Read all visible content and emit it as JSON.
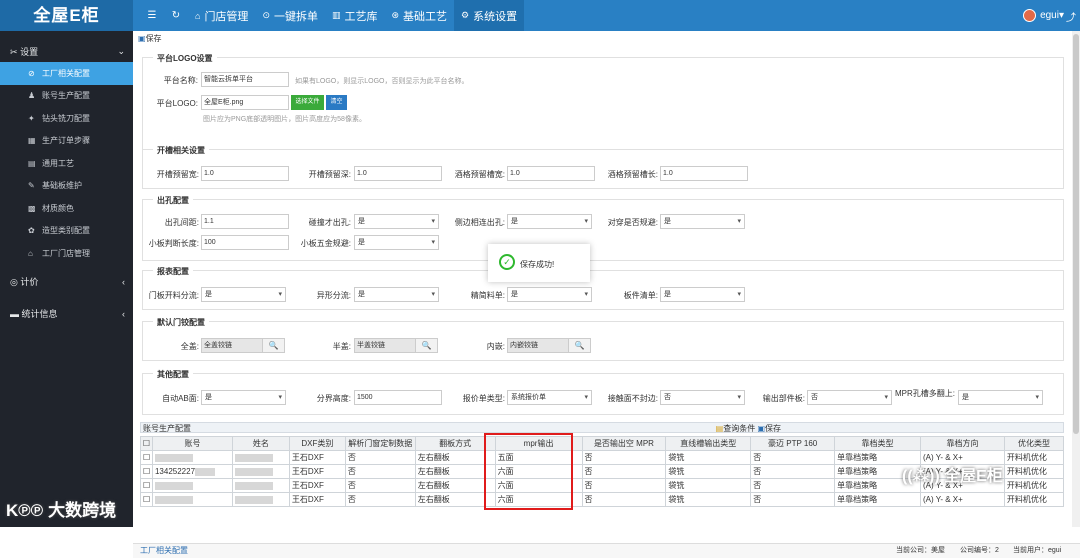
{
  "app": {
    "logo": "全屋E柜",
    "user": "egui",
    "user_caret": "▾",
    "exit_icon": "⤴",
    "top_icons": [
      "☰",
      "↻"
    ],
    "nav": [
      {
        "icon": "⌂",
        "label": "门店管理"
      },
      {
        "icon": "⊙",
        "label": "一键拆单"
      },
      {
        "icon": "▥",
        "label": "工艺库"
      },
      {
        "icon": "⊛",
        "label": "基础工艺"
      },
      {
        "icon": "⚙",
        "label": "系统设置",
        "active": true
      }
    ]
  },
  "sidebar": {
    "group1": {
      "icon": "✂",
      "label": "设置",
      "caret": "⌄"
    },
    "items": [
      {
        "icon": "⊘",
        "label": "工厂相关配置",
        "active": true
      },
      {
        "icon": "♟",
        "label": "账号生产配置"
      },
      {
        "icon": "✦",
        "label": "钻头铣刀配置"
      },
      {
        "icon": "▦",
        "label": "生产订单步骤"
      },
      {
        "icon": "▤",
        "label": "通用工艺"
      },
      {
        "icon": "✎",
        "label": "基础板维护"
      },
      {
        "icon": "▩",
        "label": "材质颜色"
      },
      {
        "icon": "✿",
        "label": "造型类别配置"
      },
      {
        "icon": "⌂",
        "label": "工厂门店管理"
      }
    ],
    "group2": {
      "icon": "◎",
      "label": "计价",
      "caret": "‹"
    },
    "group3": {
      "icon": "▬",
      "label": "统计信息",
      "caret": "‹"
    }
  },
  "toolbar": {
    "icon": "▣",
    "save": "保存"
  },
  "logo_section": {
    "title": "平台LOGO设置",
    "name_label": "平台名称:",
    "name_value": "智能云拆单平台",
    "name_hint": "如果有LOGO，则显示LOGO，否则显示为此平台名称。",
    "logo_label": "平台LOGO:",
    "logo_value": "全屋E柜.png",
    "choose_btn": "选择文件",
    "clear_btn": "清空",
    "logo_hint": "图片应为PNG底部透明图片，图片高度应为58像素。"
  },
  "slot_section": {
    "title": "开槽相关设置",
    "fields": [
      {
        "label": "开槽预留宽:",
        "value": "1.0"
      },
      {
        "label": "开槽预留深:",
        "value": "1.0"
      },
      {
        "label": "酒格预留槽宽:",
        "value": "1.0"
      },
      {
        "label": "酒格预留槽长:",
        "value": "1.0"
      }
    ]
  },
  "hole_section": {
    "title": "出孔配置",
    "row1": [
      {
        "label": "出孔间距:",
        "value": "1.1",
        "kind": "input"
      },
      {
        "label": "碰撞才出孔:",
        "value": "是",
        "kind": "select"
      },
      {
        "label": "侧边相连出孔:",
        "value": "是",
        "kind": "select"
      },
      {
        "label": "对穿是否规避:",
        "value": "是",
        "kind": "select"
      }
    ],
    "row2": [
      {
        "label": "小板判断长度:",
        "value": "100",
        "kind": "input"
      },
      {
        "label": "小板五金规避:",
        "value": "是",
        "kind": "select"
      }
    ]
  },
  "report_section": {
    "title": "报表配置",
    "fields": [
      {
        "label": "门板开料分流:",
        "value": "是"
      },
      {
        "label": "异形分流:",
        "value": "是"
      },
      {
        "label": "精简料单:",
        "value": "是"
      },
      {
        "label": "板件清单:",
        "value": "是"
      }
    ]
  },
  "door_section": {
    "title": "默认门铰配置",
    "lookup_icon": "🔍",
    "fields": [
      {
        "label": "全盖:",
        "value": "全盖铰链"
      },
      {
        "label": "半盖:",
        "value": "半盖铰链"
      },
      {
        "label": "内嵌:",
        "value": "内嵌铰链"
      }
    ]
  },
  "other_section": {
    "title": "其他配置",
    "fields": [
      {
        "label": "自动AB面:",
        "value": "是",
        "kind": "select"
      },
      {
        "label": "分界高度:",
        "value": "1500",
        "kind": "input"
      },
      {
        "label": "报价单类型:",
        "value": "系统报价单",
        "kind": "select"
      },
      {
        "label": "接触面不封边:",
        "value": "否",
        "kind": "select"
      },
      {
        "label": "输出部件板:",
        "value": "否",
        "kind": "select"
      },
      {
        "label": "MPR孔槽多翻上:",
        "value": "是",
        "kind": "select"
      }
    ]
  },
  "grid": {
    "title": "账号生产配置",
    "query_icon": "▤",
    "query": "查询条件",
    "save_icon": "▣",
    "save": "保存",
    "columns": [
      "账号",
      "姓名",
      "DXF类别",
      "解析门窗定制数据",
      "翻板方式",
      "mpr输出",
      "是否输出空 MPR",
      "直线槽输出类型",
      "豪迈 PTP 160",
      "靠档类型",
      "靠档方向",
      "优化类型"
    ],
    "rows": [
      [
        "",
        "",
        "王石DXF",
        "否",
        "左右翻板",
        "五面",
        "否",
        "袋铣",
        "否",
        "单靠档策略",
        "(A) Y- & X+",
        "开料机优化"
      ],
      [
        "134252227",
        "",
        "王石DXF",
        "否",
        "左右翻板",
        "六面",
        "否",
        "袋铣",
        "否",
        "单靠档策略",
        "(A) Y- & X+",
        "开料机优化"
      ],
      [
        "",
        "",
        "王石DXF",
        "否",
        "左右翻板",
        "六面",
        "否",
        "袋铣",
        "否",
        "单靠档策略",
        "(A) Y- & X+",
        "开料机优化"
      ],
      [
        "",
        "",
        "王石DXF",
        "否",
        "左右翻板",
        "六面",
        "否",
        "袋铣",
        "否",
        "单靠档策略",
        "(A) Y- & X+",
        "开料机优化"
      ]
    ]
  },
  "toast": {
    "icon": "✓",
    "text": "保存成功!"
  },
  "footer": {
    "tab": "工厂相关配置",
    "company": "当前公司：美屋",
    "company_no": "公司编号：2",
    "cur_user": "当前用户：egui"
  },
  "watermark": {
    "left": "大数跨境",
    "right": "全屋E柜",
    "left_mark": "K℗℗",
    "right_mark": "((⁂))"
  },
  "colors": {
    "topbar": "#2980c4",
    "sidebar": "#20242c",
    "active": "#3ea2e3",
    "highlight": "#e01b1b"
  }
}
